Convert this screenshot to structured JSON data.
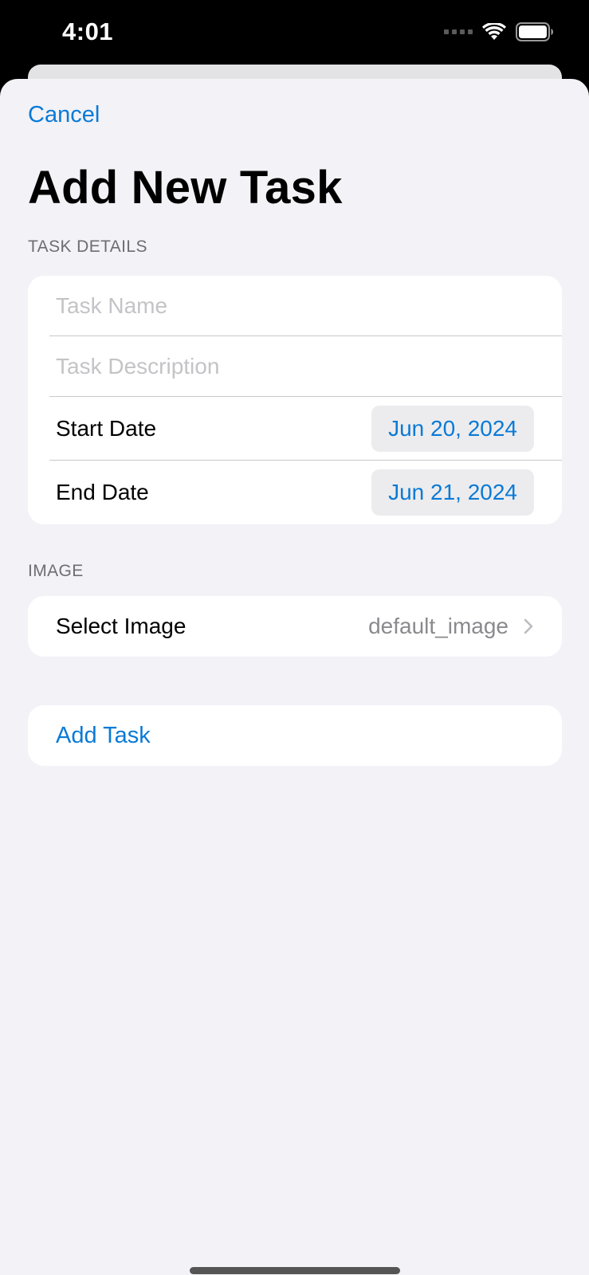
{
  "status_bar": {
    "time": "4:01"
  },
  "nav": {
    "cancel_label": "Cancel",
    "title": "Add New Task"
  },
  "task_details": {
    "header": "TASK DETAILS",
    "name_placeholder": "Task Name",
    "name_value": "",
    "description_placeholder": "Task Description",
    "description_value": "",
    "start_date_label": "Start Date",
    "start_date_value": "Jun 20, 2024",
    "end_date_label": "End Date",
    "end_date_value": "Jun 21, 2024"
  },
  "image_section": {
    "header": "IMAGE",
    "select_label": "Select Image",
    "select_value": "default_image"
  },
  "actions": {
    "add_task_label": "Add Task"
  },
  "colors": {
    "accent": "#0a7ad6",
    "background": "#f2f2f7",
    "card": "#ffffff",
    "secondary_text": "#8a8a8e"
  },
  "icons": {
    "signal": "signal-icon",
    "wifi": "wifi-icon",
    "battery": "battery-icon",
    "chevron": "chevron-right-icon"
  }
}
